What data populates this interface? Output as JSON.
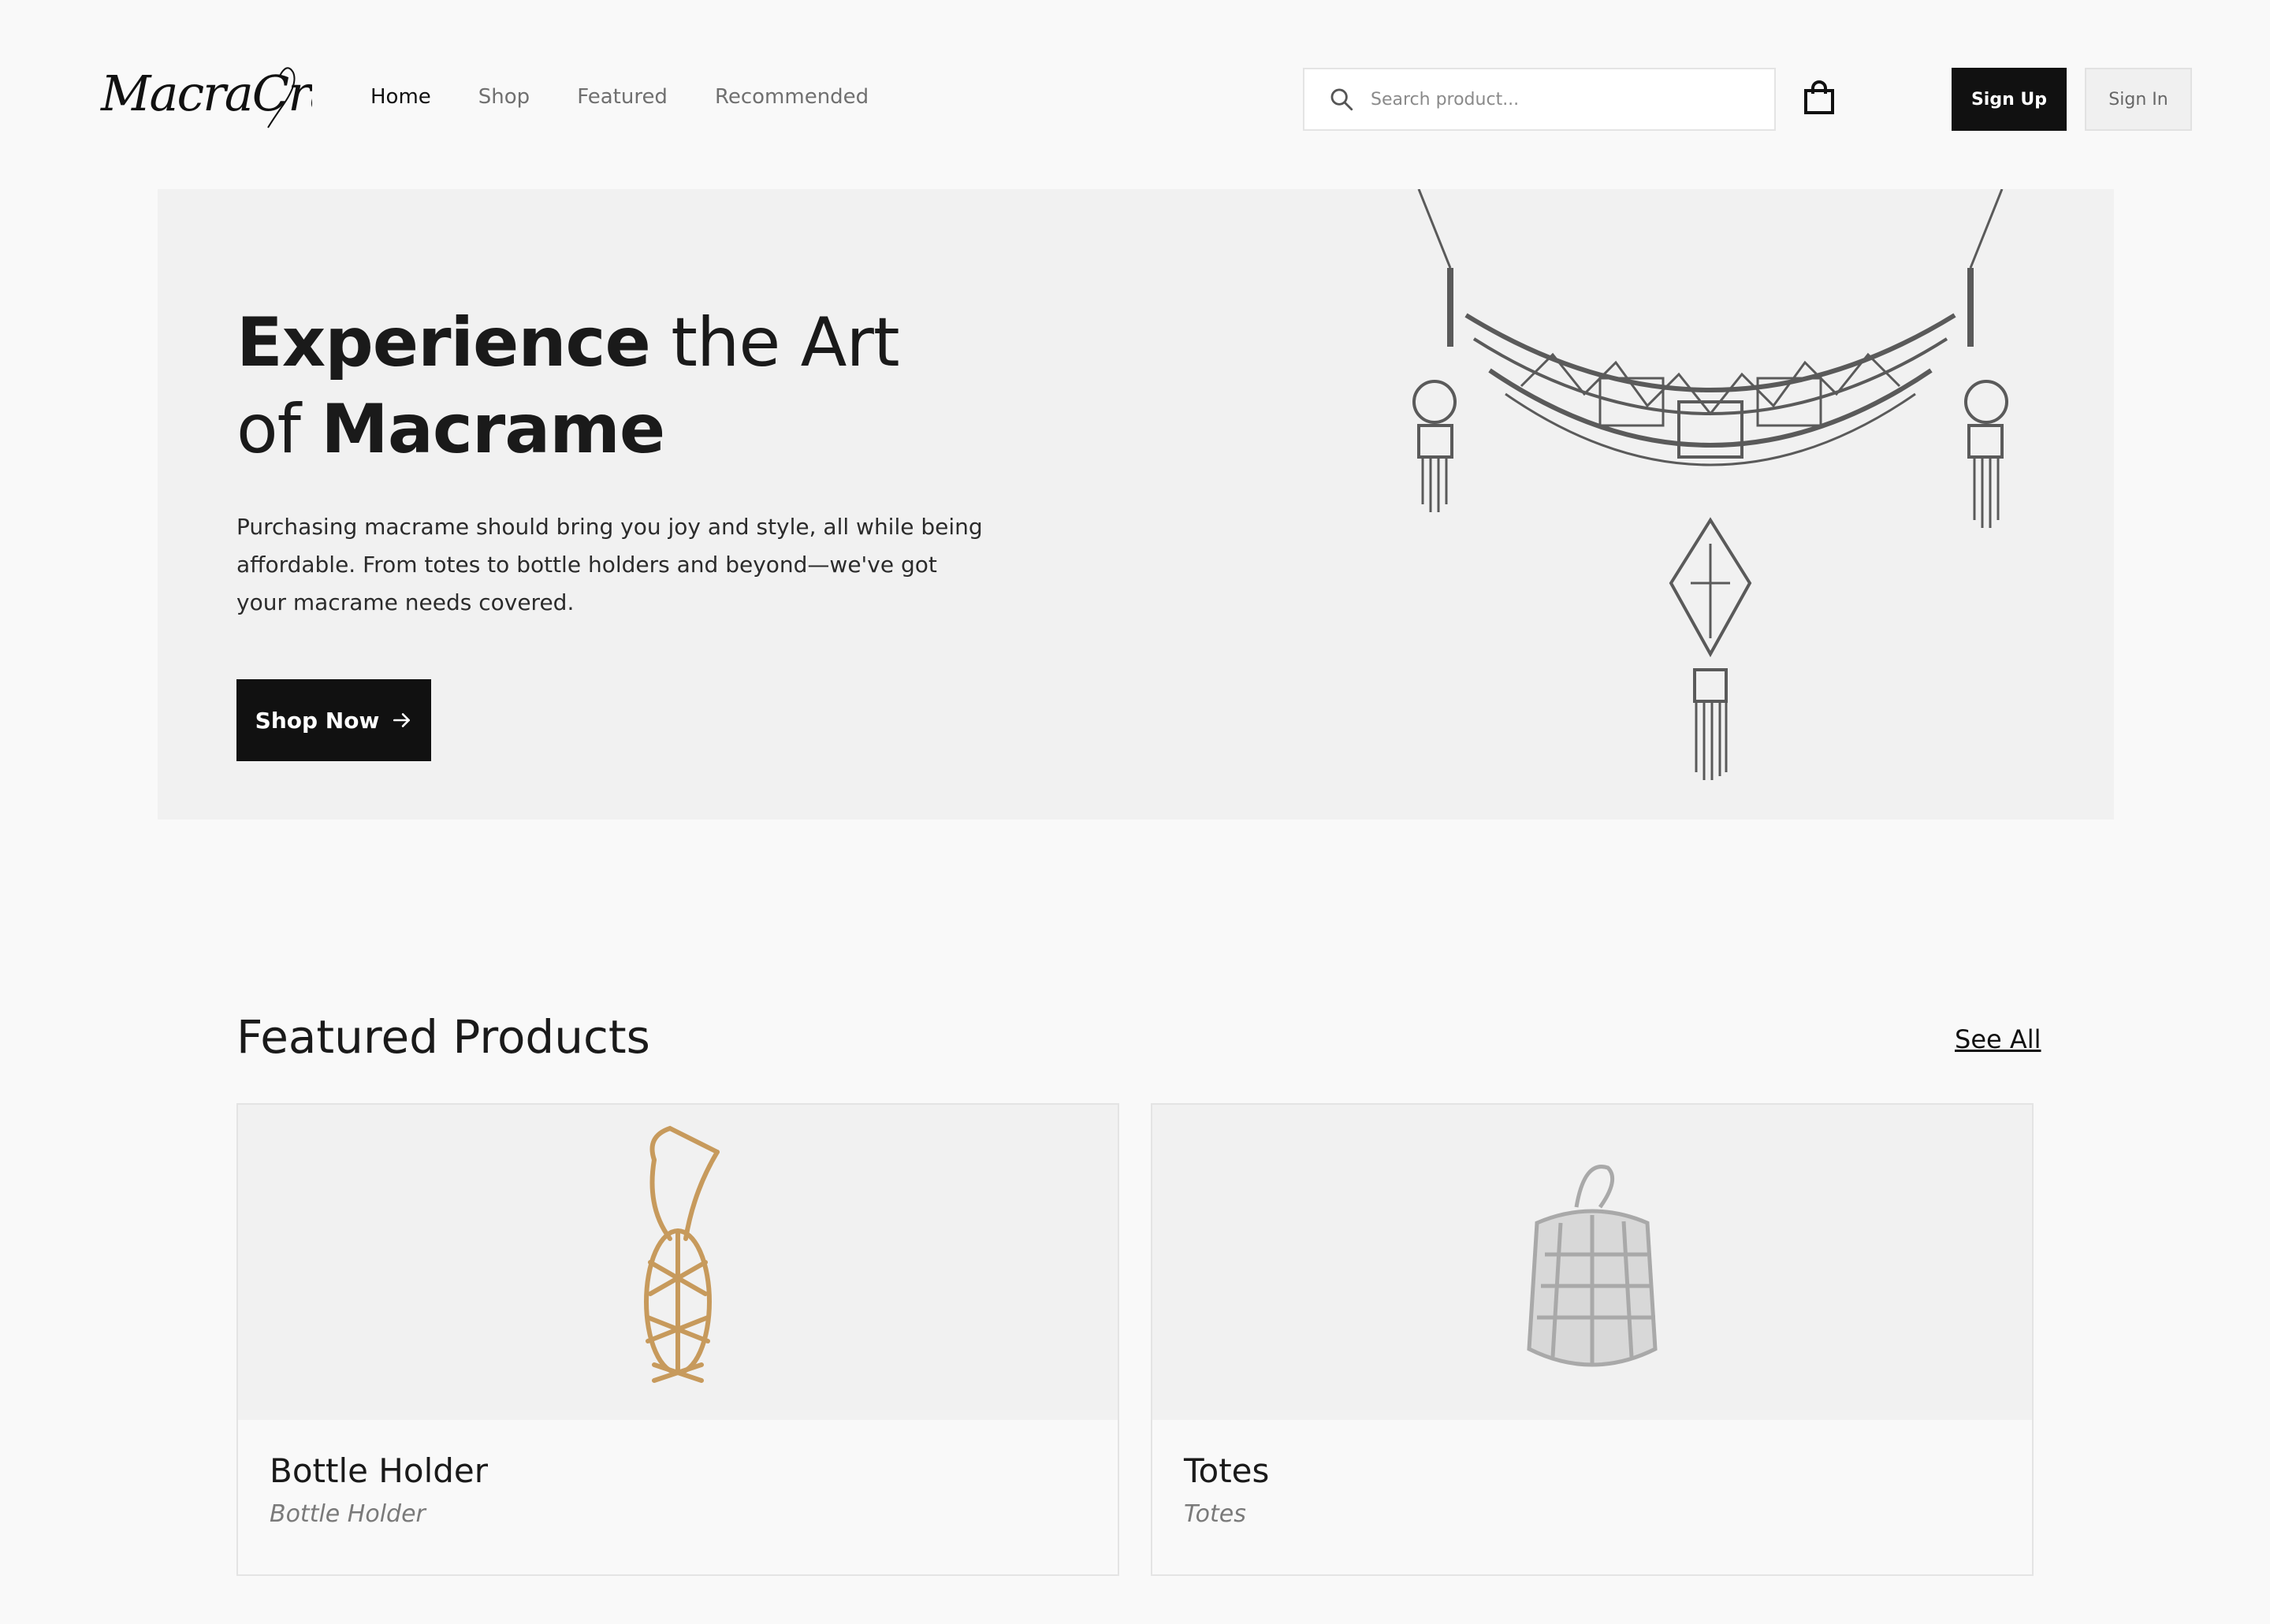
{
  "brand": {
    "logo_text": "MacraCraft"
  },
  "nav": {
    "items": [
      {
        "label": "Home",
        "active": true
      },
      {
        "label": "Shop",
        "active": false
      },
      {
        "label": "Featured",
        "active": false
      },
      {
        "label": "Recommended",
        "active": false
      }
    ]
  },
  "search": {
    "placeholder": "Search product...",
    "value": ""
  },
  "header": {
    "signup_label": "Sign Up",
    "signin_label": "Sign In",
    "bag_icon": "shopping-bag-icon"
  },
  "hero": {
    "title_bold_1": "Experience",
    "title_light_1": " the Art",
    "title_light_2": "of ",
    "title_bold_2": "Macrame",
    "description": "Purchasing macrame should bring you joy and style, all while being affordable. From totes to bottle holders and beyond—we've got your macrame needs covered.",
    "cta_label": "Shop Now",
    "image_subject": "macrame necklace illustration"
  },
  "featured": {
    "title": "Featured Products",
    "see_all_label": "See All",
    "products": [
      {
        "name": "Bottle Holder",
        "category": "Bottle Holder",
        "image_subject": "macrame bottle holder"
      },
      {
        "name": "Totes",
        "category": "Totes",
        "image_subject": "macrame tote bag"
      }
    ]
  },
  "colors": {
    "background": "#f9f9f9",
    "hero_background": "#f1f1f1",
    "primary_button": "#111111",
    "muted_text": "#707070"
  }
}
